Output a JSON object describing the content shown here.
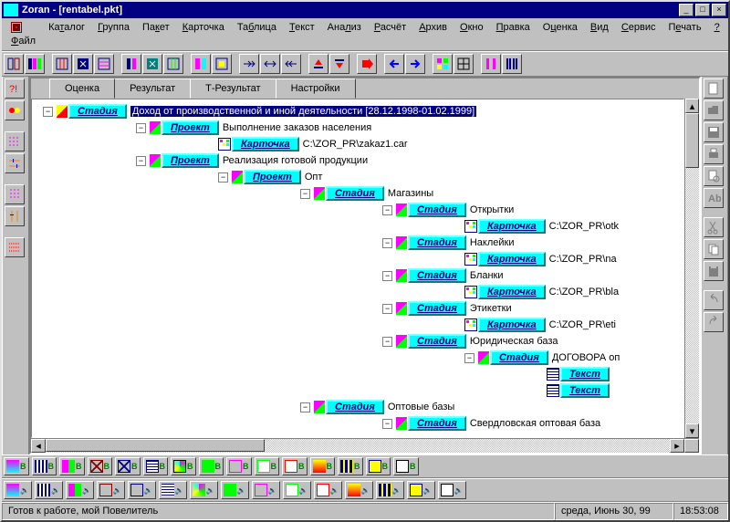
{
  "title": "Zoran - [rentabel.pkt]",
  "menu": [
    "Файл",
    "Каталог",
    "Группа",
    "Пакет",
    "Карточка",
    "Таблица",
    "Текст",
    "Анализ",
    "Расчёт",
    "Архив",
    "Окно",
    "Правка",
    "Оценка",
    "Вид",
    "Сервис",
    "Печать",
    "?"
  ],
  "tabs": [
    "Оценка",
    "Результат",
    "Т-Результат",
    "Настройки"
  ],
  "tree": {
    "root_type": "Стадия",
    "root_text": "Доход от производственной и иной деятельности [28.12.1998-01.02.1999]",
    "n1_type": "Проект",
    "n1_text": "Выполнение заказов населения",
    "n1c_type": "Карточка",
    "n1c_text": "C:\\ZOR_PR\\zakaz1.car",
    "n2_type": "Проект",
    "n2_text": "Реализация готовой продукции",
    "n2a_type": "Проект",
    "n2a_text": "Опт",
    "n2a1_type": "Стадия",
    "n2a1_text": "Магазины",
    "n2a1a_type": "Стадия",
    "n2a1a_text": "Открытки",
    "n2a1a_c_type": "Карточка",
    "n2a1a_c_text": "C:\\ZOR_PR\\otk",
    "n2a1b_type": "Стадия",
    "n2a1b_text": "Наклейки",
    "n2a1b_c_type": "Карточка",
    "n2a1b_c_text": "C:\\ZOR_PR\\na",
    "n2a1c_type": "Стадия",
    "n2a1c_text": "Бланки",
    "n2a1c_c_type": "Карточка",
    "n2a1c_c_text": "C:\\ZOR_PR\\bla",
    "n2a1d_type": "Стадия",
    "n2a1d_text": "Этикетки",
    "n2a1d_c_type": "Карточка",
    "n2a1d_c_text": "C:\\ZOR_PR\\eti",
    "n2a1e_type": "Стадия",
    "n2a1e_text": "Юридическая база",
    "n2a1e1_type": "Стадия",
    "n2a1e1_text": "ДОГОВОРА оп",
    "n2a1e1t1_type": "Текст",
    "n2a1e1t2_type": "Текст",
    "n2a2_type": "Стадия",
    "n2a2_text": "Оптовые базы",
    "n2a2a_type": "Стадия",
    "n2a2a_text": "Свердловская оптовая база"
  },
  "status": {
    "msg": "Готов к работе, мой Повелитель",
    "date": "среда, Июнь 30, 99",
    "time": "18:53:08"
  }
}
